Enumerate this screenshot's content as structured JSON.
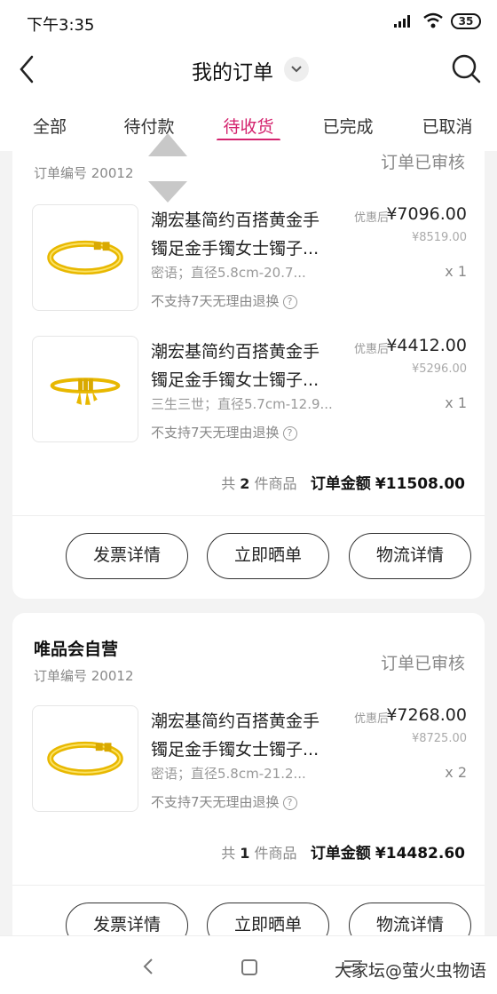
{
  "status_bar": {
    "time": "下午3:35",
    "battery": "35"
  },
  "header": {
    "title": "我的订单"
  },
  "tabs": [
    {
      "label": "全部"
    },
    {
      "label": "待付款"
    },
    {
      "label": "待收货",
      "active": true
    },
    {
      "label": "已完成"
    },
    {
      "label": "已取消"
    }
  ],
  "orders": [
    {
      "status": "订单已审核",
      "order_no": "订单编号 20012",
      "items": [
        {
          "name_line1": "潮宏基简约百搭黄金手",
          "name_line2": "镯足金手镯女士镯子...",
          "spec": "密语；直径5.8cm-20.7...",
          "note": "不支持7天无理由退换",
          "discount_label": "优惠后",
          "price": "¥7096.00",
          "original_price": "¥8519.00",
          "qty": "x 1"
        },
        {
          "name_line1": "潮宏基简约百搭黄金手",
          "name_line2": "镯足金手镯女士镯子...",
          "spec": "三生三世；直径5.7cm-12.9...",
          "note": "不支持7天无理由退换",
          "discount_label": "优惠后",
          "price": "¥4412.00",
          "original_price": "¥5296.00",
          "qty": "x 1"
        }
      ],
      "summary": {
        "prefix": "共",
        "count": "2",
        "suffix": "件商品",
        "amount_label": "订单金额",
        "amount": "¥11508.00"
      },
      "buttons": [
        "发票详情",
        "立即晒单",
        "物流详情"
      ]
    },
    {
      "shop": "唯品会自营",
      "status": "订单已审核",
      "order_no": "订单编号 20012",
      "items": [
        {
          "name_line1": "潮宏基简约百搭黄金手",
          "name_line2": "镯足金手镯女士镯子...",
          "spec": "密语；直径5.8cm-21.2...",
          "note": "不支持7天无理由退换",
          "discount_label": "优惠后",
          "price": "¥7268.00",
          "original_price": "¥8725.00",
          "qty": "x 2"
        }
      ],
      "summary": {
        "prefix": "共",
        "count": "1",
        "suffix": "件商品",
        "amount_label": "订单金额",
        "amount": "¥14482.60"
      },
      "buttons": [
        "发票详情",
        "立即晒单",
        "物流详情"
      ]
    }
  ],
  "watermark": "大家坛@萤火虫物语",
  "colors": {
    "accent": "#d4236e",
    "gold": "#f2c200"
  }
}
